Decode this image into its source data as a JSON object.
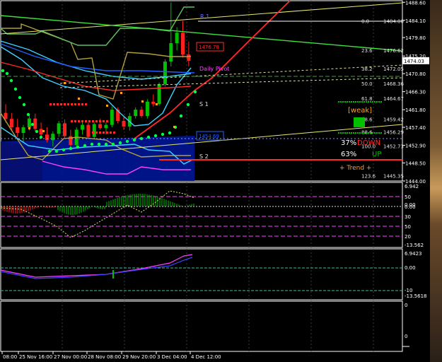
{
  "colors": {
    "bg": "#000000",
    "frame": "#ffffff",
    "grid": "#3c3c3c",
    "bull": "#00c000",
    "bear": "#ff2020",
    "ma_red": "#ff2a2a",
    "ma_cyan": "#40d0ff",
    "ma_blue": "#2060ff",
    "yellow": "#e8e870",
    "green_line": "#40e040",
    "magenta": "#ff40ff",
    "orange": "#ffa020",
    "sar": "#00ff40",
    "fill_blue": "#0018a0"
  },
  "chart_data": [
    {
      "type": "candlestick",
      "title": "",
      "y_ticks": [
        "1488.60",
        "1484.10",
        "1479.80",
        "1475.20",
        "1470.80",
        "1466.30",
        "1461.80",
        "1457.40",
        "1452.90",
        "1448.50",
        "1444.00"
      ],
      "ylim": [
        1444.0,
        1489.0
      ],
      "current_price": "1474.03",
      "x_ticks": [
        "08:00",
        "25 Nov 16:00",
        "27 Nov 00:00",
        "28 Nov 08:00",
        "29 Nov 20:00",
        "3 Dec 04:00",
        "4 Dec 12:00"
      ],
      "fib_levels": [
        {
          "ratio": "0.0",
          "price": "1484.00"
        },
        {
          "ratio": "23.6",
          "price": "1476.62"
        },
        {
          "ratio": "38.2",
          "price": "1472.05"
        },
        {
          "ratio": "50.0",
          "price": "1468.36"
        },
        {
          "ratio": "61.8",
          "price": "1464.67"
        },
        {
          "ratio": "78.6",
          "price": "1459.42"
        },
        {
          "ratio": "88.6",
          "price": "1456.29"
        },
        {
          "ratio": "100.0",
          "price": "1452.73"
        },
        {
          "ratio": "123.6",
          "price": "1445.35"
        }
      ],
      "pivot_labels": [
        "R 1",
        "Daily Pivot",
        "S 1",
        "S 2"
      ],
      "box_labels": [
        "1476.78",
        "1454.69"
      ],
      "panel_text": {
        "weak": "[weak]",
        "down_pct": "37%",
        "down_word": "DOWN",
        "up_pct": "63%",
        "up_word": "UP",
        "trend": "+   Trend   +"
      },
      "candles": [
        {
          "o": 1461.0,
          "h": 1463.2,
          "l": 1458.6,
          "c": 1459.5
        },
        {
          "o": 1459.5,
          "h": 1461.0,
          "l": 1456.5,
          "c": 1457.4
        },
        {
          "o": 1457.4,
          "h": 1459.5,
          "l": 1455.0,
          "c": 1456.0
        },
        {
          "o": 1456.0,
          "h": 1458.0,
          "l": 1453.8,
          "c": 1457.4
        },
        {
          "o": 1457.4,
          "h": 1460.4,
          "l": 1456.6,
          "c": 1459.6
        },
        {
          "o": 1459.6,
          "h": 1460.8,
          "l": 1456.4,
          "c": 1457.0
        },
        {
          "o": 1457.0,
          "h": 1458.6,
          "l": 1454.8,
          "c": 1455.6
        },
        {
          "o": 1455.6,
          "h": 1457.4,
          "l": 1453.6,
          "c": 1454.2
        },
        {
          "o": 1454.2,
          "h": 1456.4,
          "l": 1452.6,
          "c": 1455.8
        },
        {
          "o": 1455.8,
          "h": 1459.0,
          "l": 1455.0,
          "c": 1458.4
        },
        {
          "o": 1458.4,
          "h": 1459.4,
          "l": 1454.8,
          "c": 1455.2
        },
        {
          "o": 1455.2,
          "h": 1456.8,
          "l": 1452.4,
          "c": 1453.0
        },
        {
          "o": 1453.0,
          "h": 1457.4,
          "l": 1452.6,
          "c": 1456.8
        },
        {
          "o": 1456.8,
          "h": 1458.8,
          "l": 1455.6,
          "c": 1458.0
        },
        {
          "o": 1458.0,
          "h": 1458.6,
          "l": 1454.6,
          "c": 1455.0
        },
        {
          "o": 1455.0,
          "h": 1458.6,
          "l": 1454.4,
          "c": 1458.2
        },
        {
          "o": 1458.2,
          "h": 1459.6,
          "l": 1456.8,
          "c": 1457.2
        },
        {
          "o": 1457.2,
          "h": 1458.6,
          "l": 1455.6,
          "c": 1458.0
        },
        {
          "o": 1458.0,
          "h": 1462.6,
          "l": 1457.4,
          "c": 1461.8
        },
        {
          "o": 1461.8,
          "h": 1462.4,
          "l": 1458.4,
          "c": 1459.0
        },
        {
          "o": 1459.0,
          "h": 1460.0,
          "l": 1456.8,
          "c": 1457.6
        },
        {
          "o": 1457.6,
          "h": 1461.0,
          "l": 1456.6,
          "c": 1460.2
        },
        {
          "o": 1460.2,
          "h": 1462.4,
          "l": 1459.6,
          "c": 1461.8
        },
        {
          "o": 1461.8,
          "h": 1462.6,
          "l": 1459.8,
          "c": 1460.2
        },
        {
          "o": 1460.2,
          "h": 1464.4,
          "l": 1459.6,
          "c": 1463.8
        },
        {
          "o": 1463.8,
          "h": 1465.6,
          "l": 1462.6,
          "c": 1463.2
        },
        {
          "o": 1463.2,
          "h": 1468.6,
          "l": 1462.8,
          "c": 1468.2
        },
        {
          "o": 1468.2,
          "h": 1474.4,
          "l": 1467.6,
          "c": 1473.8
        },
        {
          "o": 1473.8,
          "h": 1488.6,
          "l": 1472.6,
          "c": 1478.4
        },
        {
          "o": 1478.4,
          "h": 1482.4,
          "l": 1476.6,
          "c": 1481.0
        },
        {
          "o": 1481.0,
          "h": 1484.0,
          "l": 1474.8,
          "c": 1475.6
        },
        {
          "o": 1475.6,
          "h": 1478.8,
          "l": 1472.6,
          "c": 1474.0
        }
      ]
    },
    {
      "type": "histogram",
      "y_ticks": [
        "6.942",
        "0.00",
        "-13.562"
      ],
      "levels": [
        "50",
        "0.00",
        "30",
        "50",
        "20"
      ]
    },
    {
      "type": "line",
      "y_ticks": [
        "6.9423",
        "0.00",
        "-10",
        "-13.5618"
      ]
    },
    {
      "type": "line",
      "y_ticks": [
        "0",
        "0"
      ]
    }
  ]
}
